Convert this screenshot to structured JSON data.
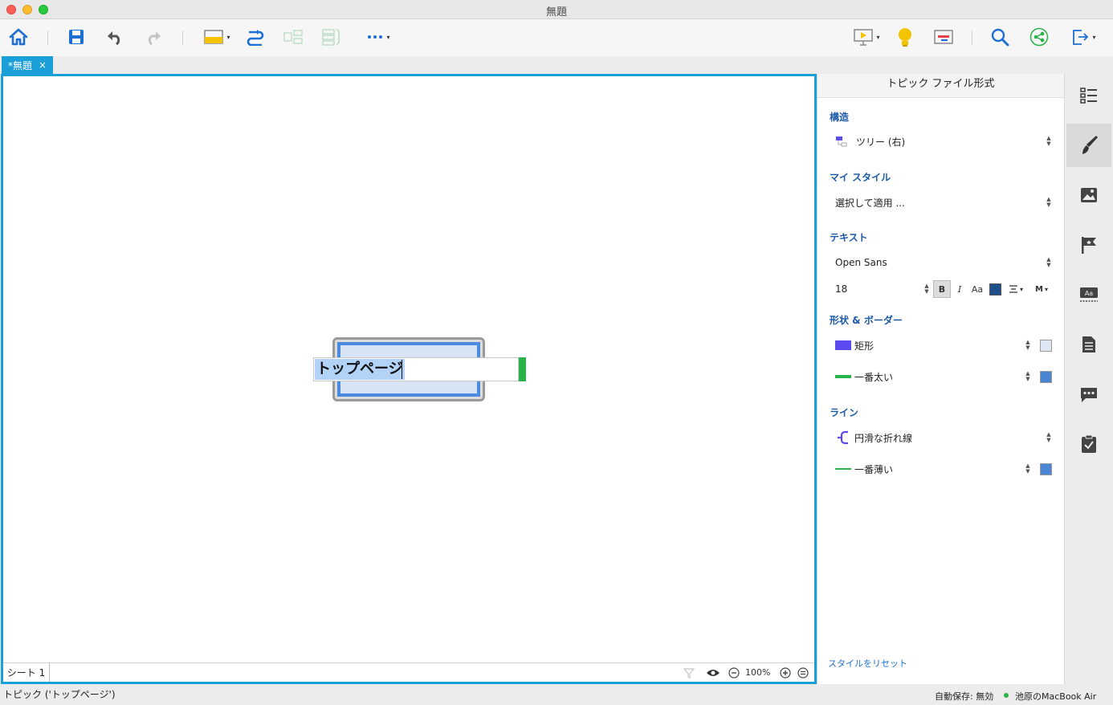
{
  "window": {
    "title": "無題"
  },
  "tabs": [
    {
      "label": "*無題",
      "close": "×"
    }
  ],
  "canvas": {
    "topic_text": "トップページ",
    "sheet_tab": "シート 1",
    "zoom_level": "100%"
  },
  "format_panel": {
    "title": "トピック ファイル形式",
    "structure": {
      "heading": "構造",
      "value": "ツリー (右)"
    },
    "my_style": {
      "heading": "マイ スタイル",
      "value": "選択して適用 ..."
    },
    "text": {
      "heading": "テキスト",
      "font": "Open Sans",
      "size": "18",
      "bold": "B",
      "italic": "I",
      "case": "Aa",
      "align_caret": "▾",
      "more": "M"
    },
    "shape_border": {
      "heading": "形状 & ボーダー",
      "shape": "矩形",
      "border": "一番太い",
      "shape_color": "#5b4bf0",
      "border_color": "#27b24a",
      "fill_swatch": "#dde6f2",
      "border_swatch": "#4a86d4"
    },
    "line": {
      "heading": "ライン",
      "style": "円滑な折れ線",
      "width": "一番薄い",
      "line_color": "#27b24a",
      "swatch": "#4a86d4"
    },
    "reset": "スタイルをリセット"
  },
  "statusbar": {
    "left": "トピック ('トップページ')",
    "autosave": "自動保存: 無効",
    "device": "池原のMacBook Air"
  },
  "colors": {
    "accent": "#1a9fd9",
    "section_heading": "#1d5aa6"
  }
}
